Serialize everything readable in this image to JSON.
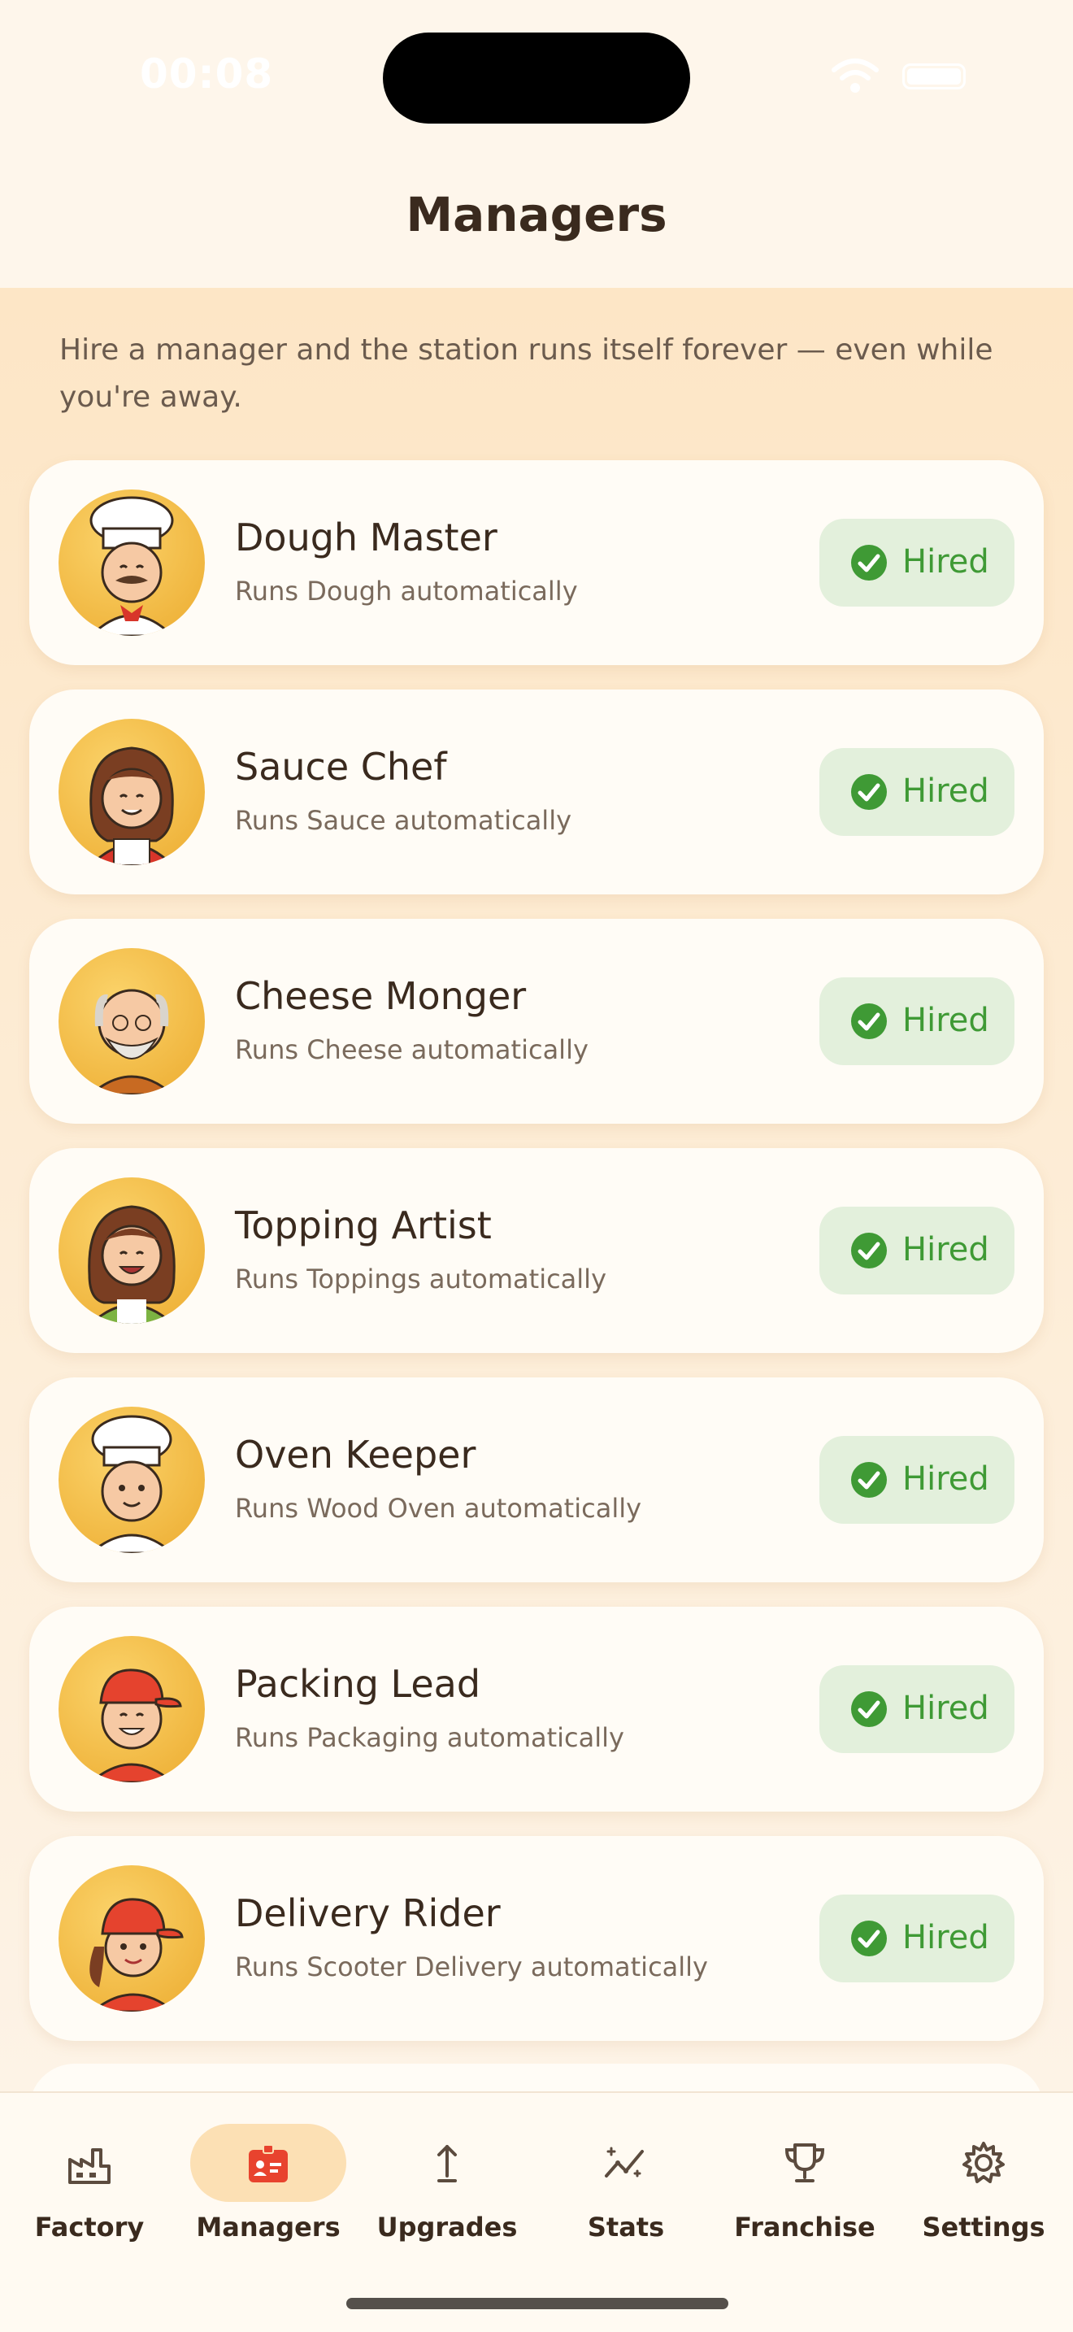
{
  "status": {
    "time": "00:08"
  },
  "header": {
    "title": "Managers"
  },
  "intro": "Hire a manager and the station runs itself forever — even while you're away.",
  "managers": [
    {
      "name": "Dough Master",
      "desc": "Runs Dough automatically",
      "status": "Hired",
      "avatar": "chef-mustache-avatar"
    },
    {
      "name": "Sauce Chef",
      "desc": "Runs Sauce automatically",
      "status": "Hired",
      "avatar": "woman-apron-avatar"
    },
    {
      "name": "Cheese Monger",
      "desc": "Runs Cheese automatically",
      "status": "Hired",
      "avatar": "old-man-beard-avatar"
    },
    {
      "name": "Topping Artist",
      "desc": "Runs Toppings automatically",
      "status": "Hired",
      "avatar": "woman-green-avatar"
    },
    {
      "name": "Oven Keeper",
      "desc": "Runs Wood Oven automatically",
      "status": "Hired",
      "avatar": "young-chef-avatar"
    },
    {
      "name": "Packing Lead",
      "desc": "Runs Packaging automatically",
      "status": "Hired",
      "avatar": "red-cap-man-avatar"
    },
    {
      "name": "Delivery Rider",
      "desc": "Runs Scooter Delivery automatically",
      "status": "Hired",
      "avatar": "red-cap-woman-avatar"
    }
  ],
  "tabs": [
    {
      "label": "Factory",
      "icon": "factory-icon"
    },
    {
      "label": "Managers",
      "icon": "badge-icon",
      "active": true
    },
    {
      "label": "Upgrades",
      "icon": "arrow-up-icon"
    },
    {
      "label": "Stats",
      "icon": "chart-icon"
    },
    {
      "label": "Franchise",
      "icon": "trophy-icon"
    },
    {
      "label": "Settings",
      "icon": "gear-icon"
    }
  ],
  "colors": {
    "accent": "#e8432e",
    "hired_bg": "#e3f0dc",
    "hired_text": "#3f9a35",
    "active_tab": "#fce0b4"
  }
}
